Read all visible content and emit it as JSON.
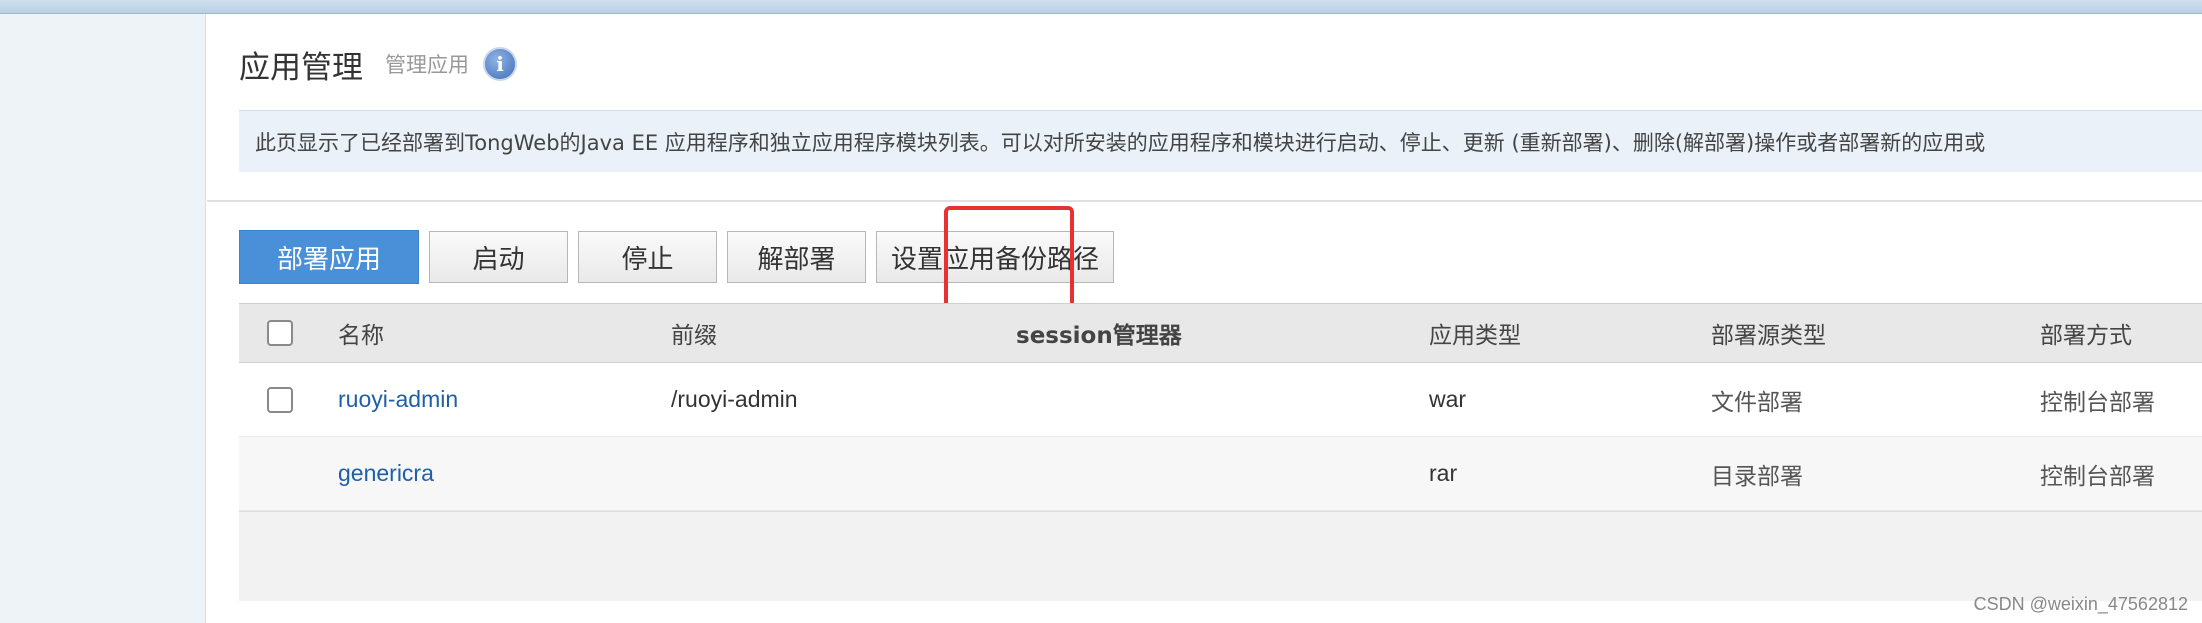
{
  "header": {
    "title": "应用管理",
    "subtitle": "管理应用",
    "info_icon": "info-icon"
  },
  "description": "此页显示了已经部署到TongWeb的Java EE 应用程序和独立应用程序模块列表。可以对所安装的应用程序和模块进行启动、停止、更新 (重新部署)、删除(解部署)操作或者部署新的应用或",
  "toolbar": {
    "deploy_label": "部署应用",
    "start_label": "启动",
    "stop_label": "停止",
    "undeploy_label": "解部署",
    "backup_path_label": "设置应用备份路径"
  },
  "table": {
    "columns": [
      "名称",
      "前缀",
      "session管理器",
      "应用类型",
      "部署源类型",
      "部署方式"
    ],
    "rows": [
      {
        "name": "ruoyi-admin",
        "prefix": "/ruoyi-admin",
        "session": "",
        "type": "war",
        "source": "文件部署",
        "method": "控制台部署",
        "has_checkbox": true
      },
      {
        "name": "genericra",
        "prefix": "",
        "session": "",
        "type": "rar",
        "source": "目录部署",
        "method": "控制台部署",
        "has_checkbox": false
      }
    ]
  },
  "watermark": "CSDN @weixin_47562812",
  "colors": {
    "primary_button": "#4a90d9",
    "link": "#1f5fa8",
    "highlight_box": "#e53333"
  }
}
